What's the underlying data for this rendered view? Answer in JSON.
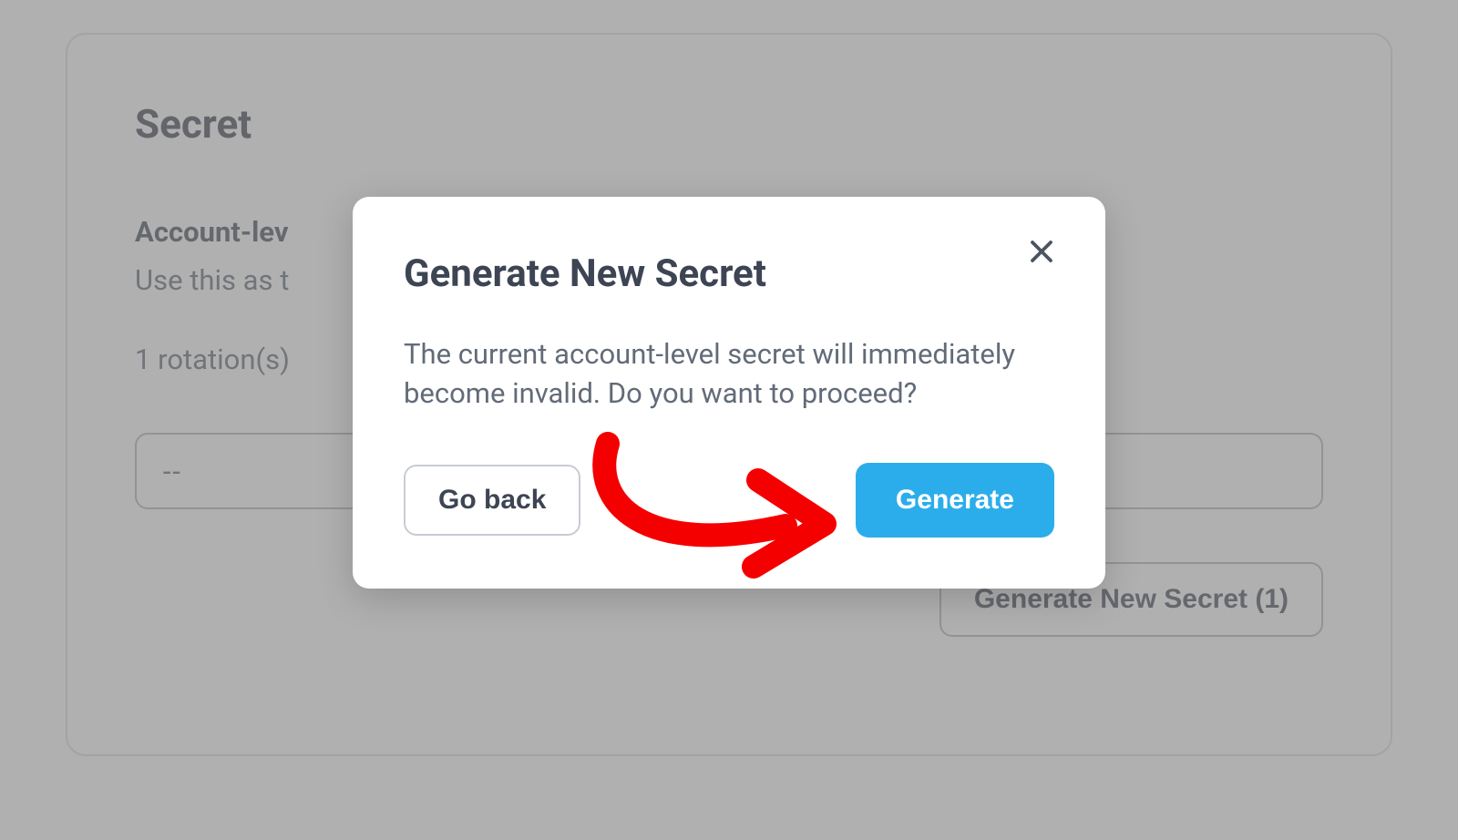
{
  "page": {
    "title": "Secret",
    "sub_heading": "Account-lev",
    "description": "Use this as t",
    "rotations_text": "1 rotation(s)",
    "secret_value": "--",
    "generate_new_button": "Generate New Secret (1)"
  },
  "modal": {
    "title": "Generate New Secret",
    "body": "The current account-level secret will immediately become invalid. Do you want to proceed?",
    "go_back_label": "Go back",
    "generate_label": "Generate"
  },
  "colors": {
    "primary": "#2cadeb",
    "text_dark": "#3d4554",
    "text_muted": "#626b78",
    "border": "#aeb4bb",
    "annotation": "#f40000"
  }
}
